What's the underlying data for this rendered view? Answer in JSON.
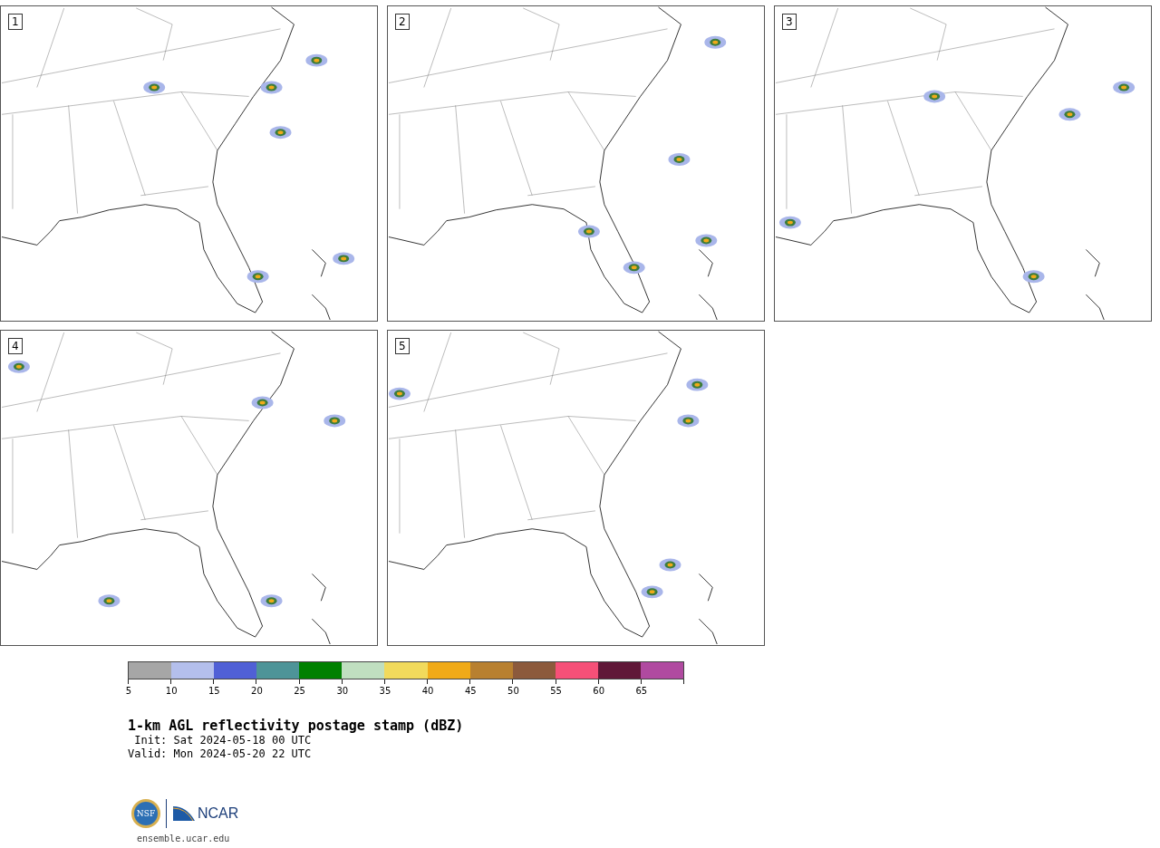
{
  "panels": [
    {
      "label": "1"
    },
    {
      "label": "2"
    },
    {
      "label": "3"
    },
    {
      "label": "4"
    },
    {
      "label": "5"
    }
  ],
  "colorbar": {
    "segments": [
      {
        "color": "#a6a6a6",
        "label": "5"
      },
      {
        "color": "#b4bfec",
        "label": "10"
      },
      {
        "color": "#5060d6",
        "label": "15"
      },
      {
        "color": "#4e9498",
        "label": "20"
      },
      {
        "color": "#008000",
        "label": "25"
      },
      {
        "color": "#c0dfc0",
        "label": "30"
      },
      {
        "color": "#f1da5c",
        "label": "35"
      },
      {
        "color": "#f0aa18",
        "label": "40"
      },
      {
        "color": "#b88030",
        "label": "45"
      },
      {
        "color": "#8c5a3c",
        "label": "50"
      },
      {
        "color": "#f55078",
        "label": "55"
      },
      {
        "color": "#601838",
        "label": "60"
      },
      {
        "color": "#b04aa0",
        "label": "65"
      }
    ]
  },
  "title": "1-km AGL reflectivity postage stamp (dBZ)",
  "init": " Init: Sat 2024-05-18 00 UTC",
  "valid": "Valid: Mon 2024-05-20 22 UTC",
  "logos": {
    "nsf": "NSF",
    "ncar": "NCAR"
  },
  "website": "ensemble.ucar.edu"
}
